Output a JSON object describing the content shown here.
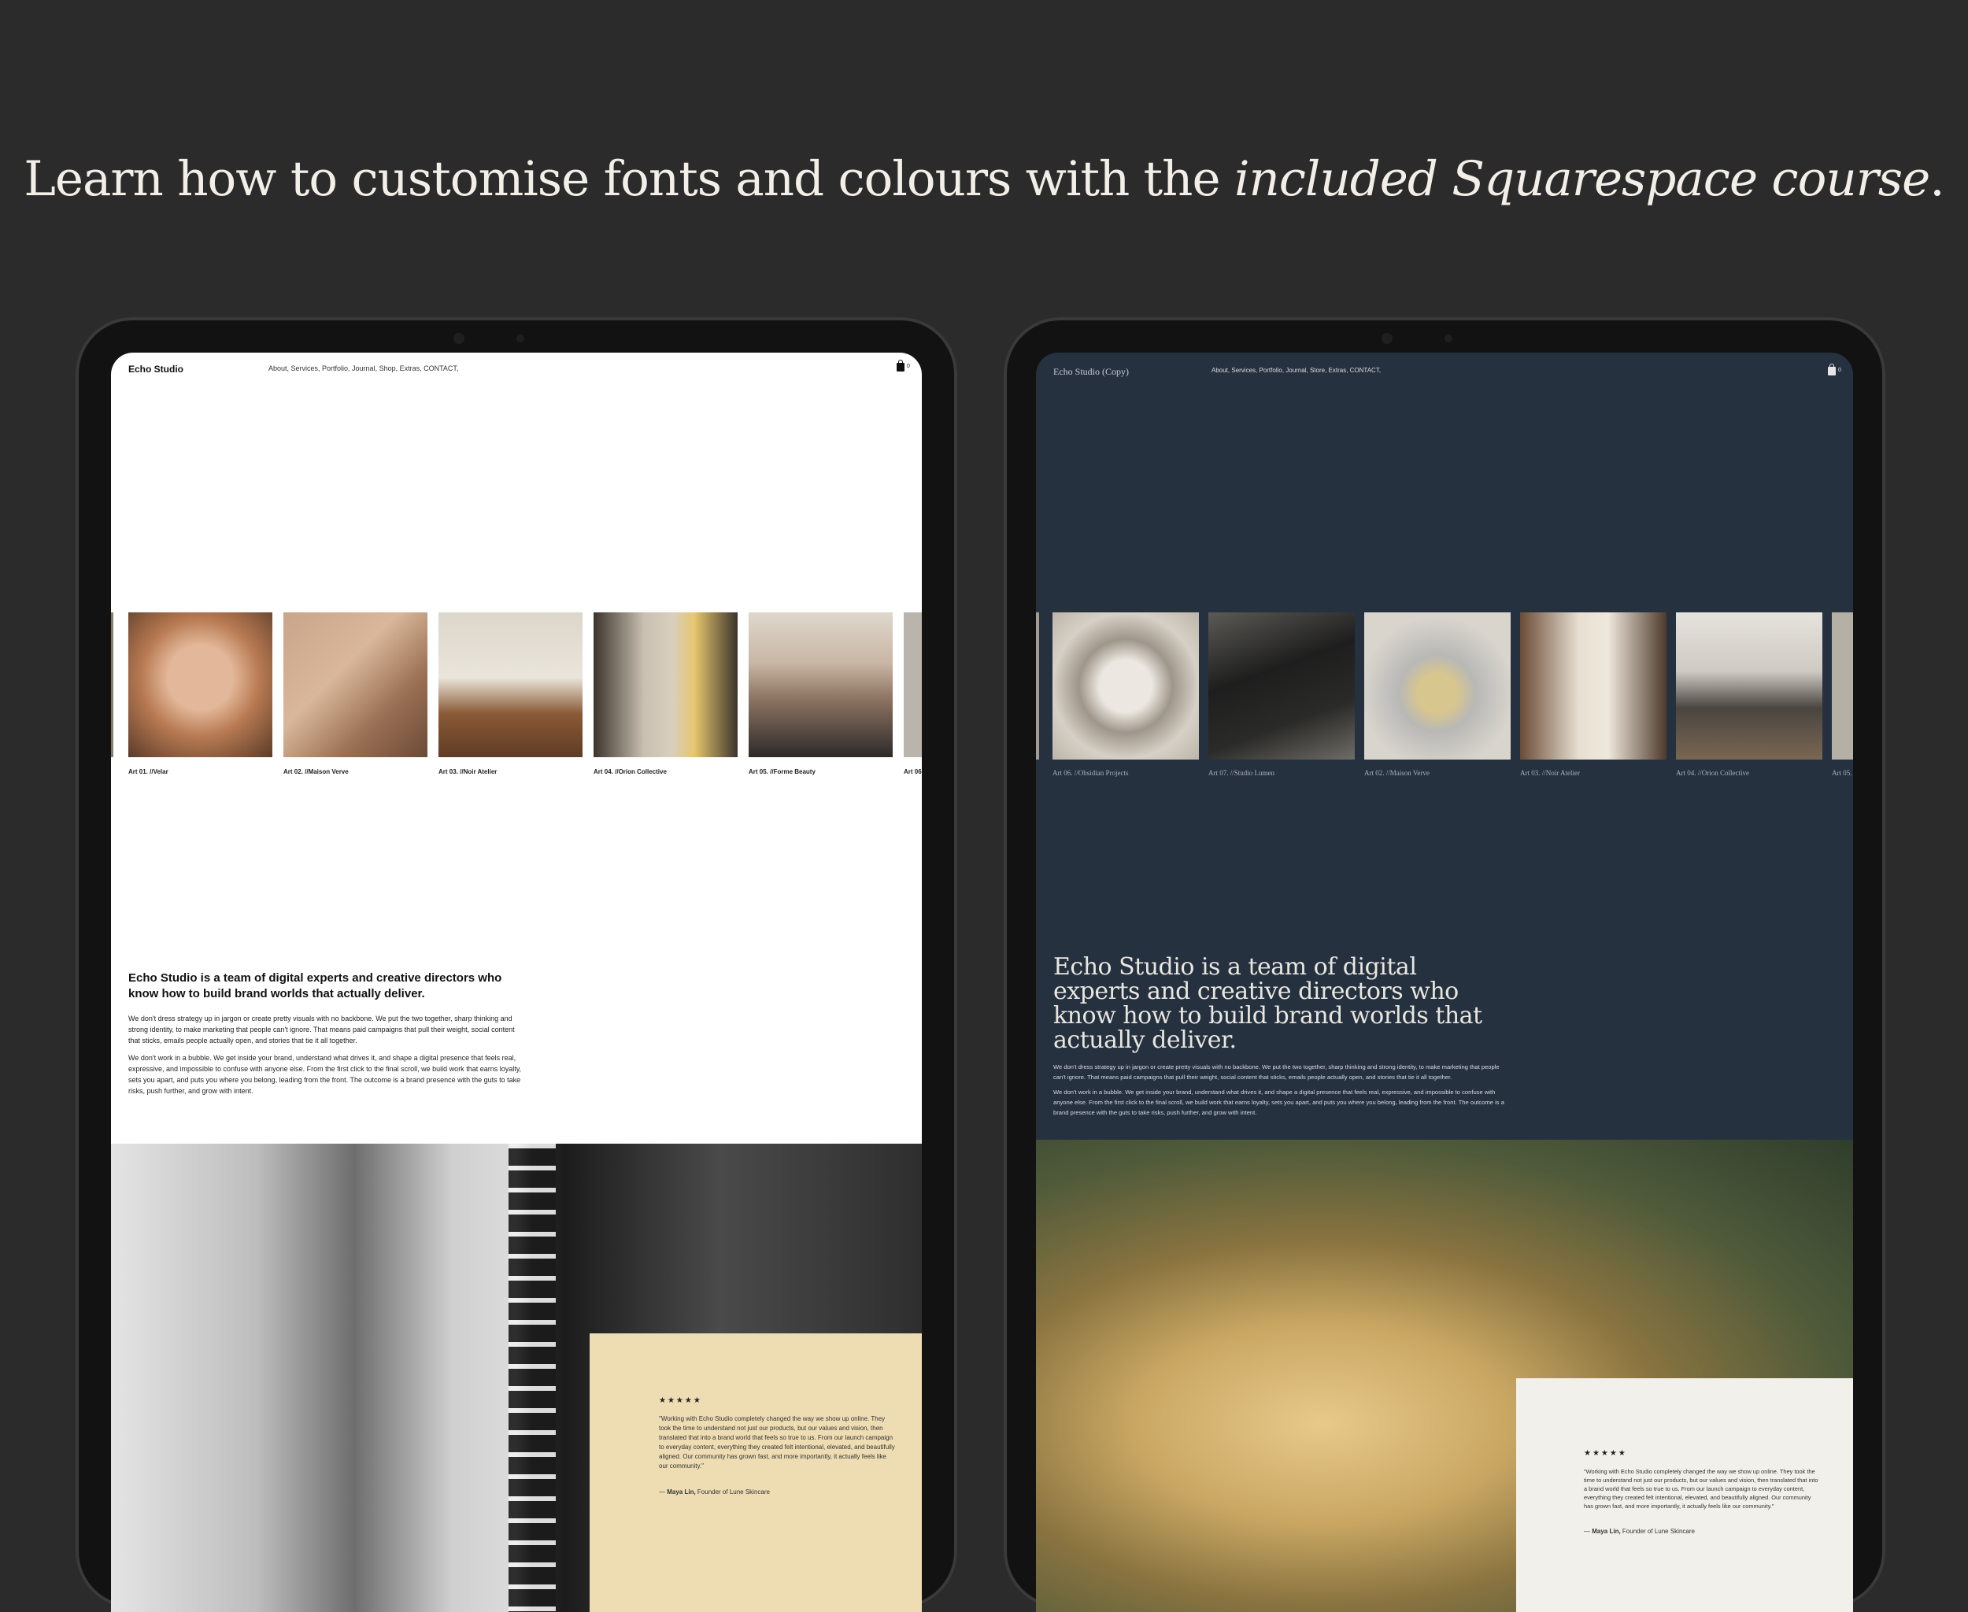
{
  "headline": {
    "plain": "Learn how to customise fonts and colours with the ",
    "italic": "included Squarespace course",
    "end": "."
  },
  "left_site": {
    "brand": "Echo Studio",
    "nav_links": "About,  Services,  Portfolio,  Journal,  Shop,  Extras,  CONTACT,",
    "cart_count": "0",
    "portfolio": [
      {
        "caption": "Art 01. //Velar"
      },
      {
        "caption": "Art 02. //Maison Verve"
      },
      {
        "caption": "Art 03. //Noir Atelier"
      },
      {
        "caption": "Art 04. //Orion Collective"
      },
      {
        "caption": "Art 05. //Forme Beauty"
      },
      {
        "caption": "Art 06."
      }
    ],
    "about_title": "Echo Studio is a team of digital experts and creative directors who know how to build brand worlds that actually deliver.",
    "about_p1": "We don't dress strategy up in jargon or create pretty visuals with no backbone. We put the two together, sharp thinking and strong identity, to make marketing that people can't ignore. That means paid campaigns that pull their weight, social content that sticks, emails people actually open, and stories that tie it all together.",
    "about_p2": "We don't work in a bubble. We get inside your brand, understand what drives it, and shape a digital presence that feels real, expressive, and impossible to confuse with anyone else. From the first click to the final scroll, we build work that earns loyalty, sets you apart, and puts you where you belong, leading from the front. The outcome is a brand presence with the guts to take risks, push further, and grow with intent.",
    "testimonial": {
      "stars": "★★★★★",
      "quote": "\"Working with Echo Studio completely changed the way we show up online. They took the time to understand not just our products, but our values and vision, then translated that into a brand world that feels so true to us. From our launch campaign to everyday content, everything they created felt intentional, elevated, and beautifully aligned. Our community has grown fast, and more importantly, it actually feels like our community.\"",
      "author_prefix": "— ",
      "author": "Maya Lin,",
      "author_role": " Founder of Lune Skincare"
    }
  },
  "right_site": {
    "brand": "Echo Studio (Copy)",
    "nav_links": "About,  Services,  Portfolio,  Journal,  Store,  Extras,  CONTACT,",
    "cart_count": "0",
    "portfolio": [
      {
        "caption": "Art 06. //Obsidian Projects"
      },
      {
        "caption": "Art 07. //Studio Lumen"
      },
      {
        "caption": "Art 02. //Maison Verve"
      },
      {
        "caption": "Art 03. //Noir Atelier"
      },
      {
        "caption": "Art 04. //Orion Collective"
      },
      {
        "caption": "Art 05."
      }
    ],
    "about_title": "Echo Studio is a team of digital experts and creative directors who know how to build brand worlds that actually deliver.",
    "about_p1": "We don't dress strategy up in jargon or create pretty visuals with no backbone. We put the two together, sharp thinking and strong identity, to make marketing that people can't ignore. That means paid campaigns that pull their weight, social content that sticks, emails people actually open, and stories that tie it all together.",
    "about_p2": "We don't work in a bubble. We get inside your brand, understand what drives it, and shape a digital presence that feels real, expressive, and impossible to confuse with anyone else. From the first click to the final scroll, we build work that earns loyalty, sets you apart, and puts you where you belong, leading from the front. The outcome is a brand presence with the guts to take risks, push further, and grow with intent.",
    "testimonial": {
      "stars": "★★★★★",
      "quote": "\"Working with Echo Studio completely changed the way we show up online. They took the time to understand not just our products, but our values and vision, then translated that into a brand world that feels so true to us. From our launch campaign to everyday content, everything they created felt intentional, elevated, and beautifully aligned. Our community has grown fast, and more importantly, it actually feels like our community.\"",
      "author_prefix": "— ",
      "author": "Maya Lin,",
      "author_role": " Founder of Lune Skincare"
    }
  },
  "colors": {
    "page_bg": "#2b2b2b",
    "left_site_bg": "#ffffff",
    "right_site_bg": "#263140",
    "left_quote_card": "#eedcb3",
    "right_quote_card": "#f2f0ea"
  }
}
